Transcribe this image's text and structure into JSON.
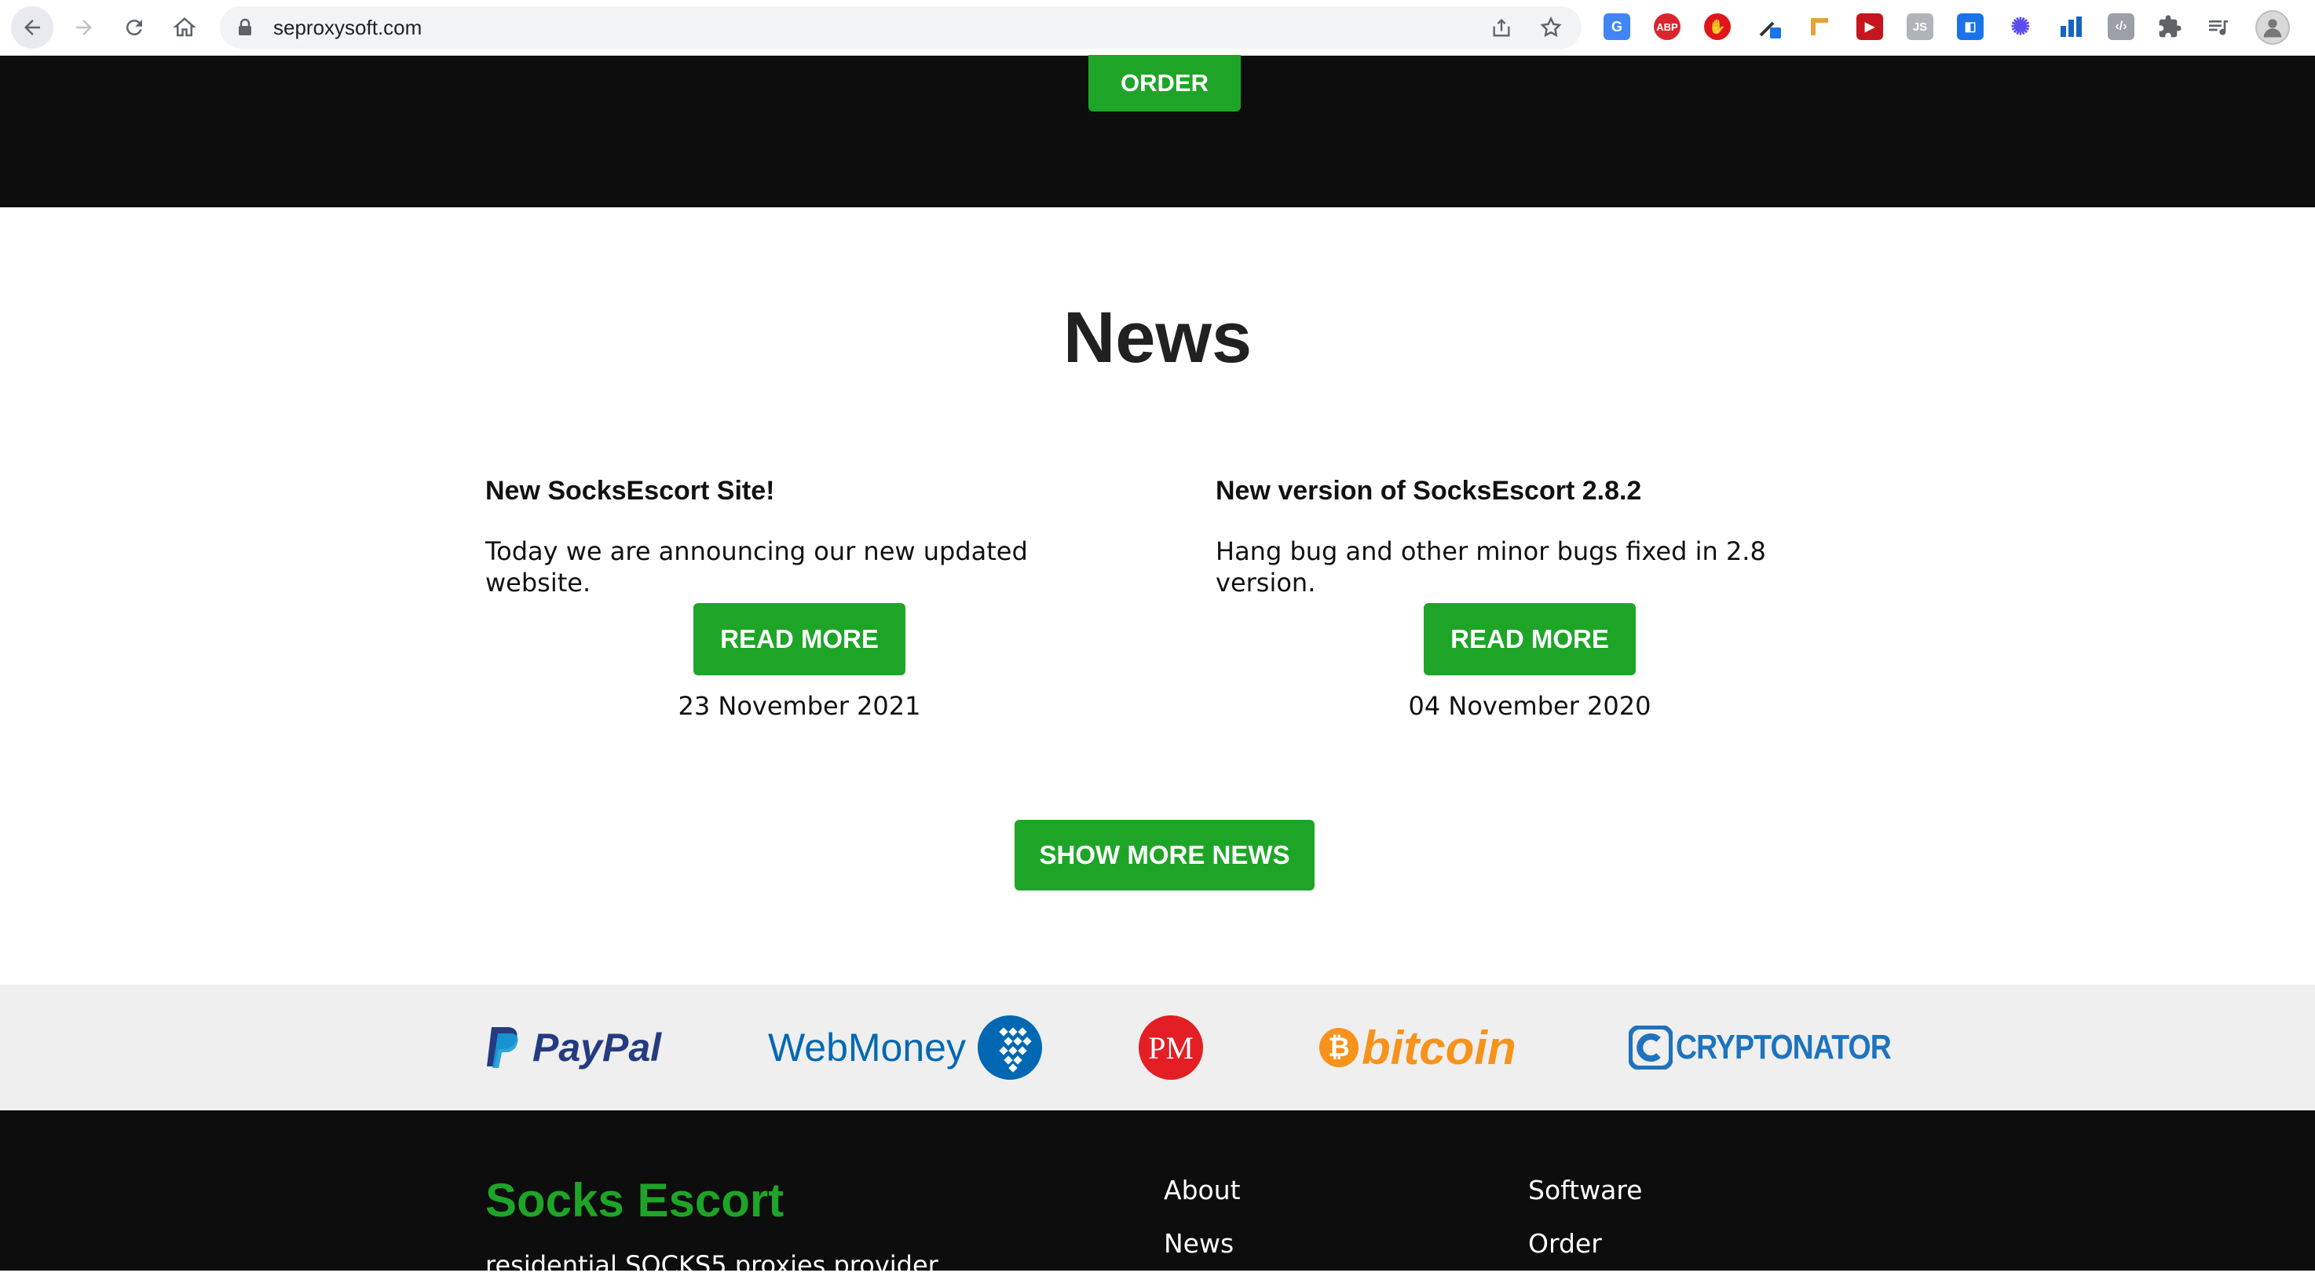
{
  "browser": {
    "url": "seproxysoft.com",
    "extensions": [
      "google-translate-icon",
      "adblock-plus-icon",
      "stop-hand-icon",
      "eyedropper-icon",
      "ruler-icon",
      "video-speed-icon",
      "javascript-icon",
      "tag-icon",
      "snowflake-icon",
      "analytics-icon",
      "code-icon",
      "puzzle-icon",
      "media-playlist-icon"
    ],
    "abp_label": "ABP",
    "js_label": "JS"
  },
  "hero": {
    "order_label": "ORDER"
  },
  "news": {
    "title": "News",
    "items": [
      {
        "headline": "New SocksEscort Site!",
        "text": "Today we are announcing our new updated website.",
        "button": "READ MORE",
        "date": "23 November 2021"
      },
      {
        "headline": "New version of SocksEscort 2.8.2",
        "text": "Hang bug and other minor bugs fixed in 2.8 version.",
        "button": "READ MORE",
        "date": "04 November 2020"
      }
    ],
    "show_more_label": "SHOW MORE NEWS"
  },
  "payments": {
    "paypal": "PayPal",
    "webmoney": "WebMoney",
    "pm": "PM",
    "bitcoin": "bitcoin",
    "cryptonator": "CRYPTONATOR"
  },
  "footer": {
    "brand": "Socks Escort",
    "tagline": "residential SOCKS5 proxies provider",
    "links": {
      "about": "About",
      "news": "News",
      "software": "Software",
      "order": "Order"
    }
  },
  "colors": {
    "accent": "#1ea528",
    "dark": "#0d0d0d",
    "paybar": "#efefef"
  }
}
